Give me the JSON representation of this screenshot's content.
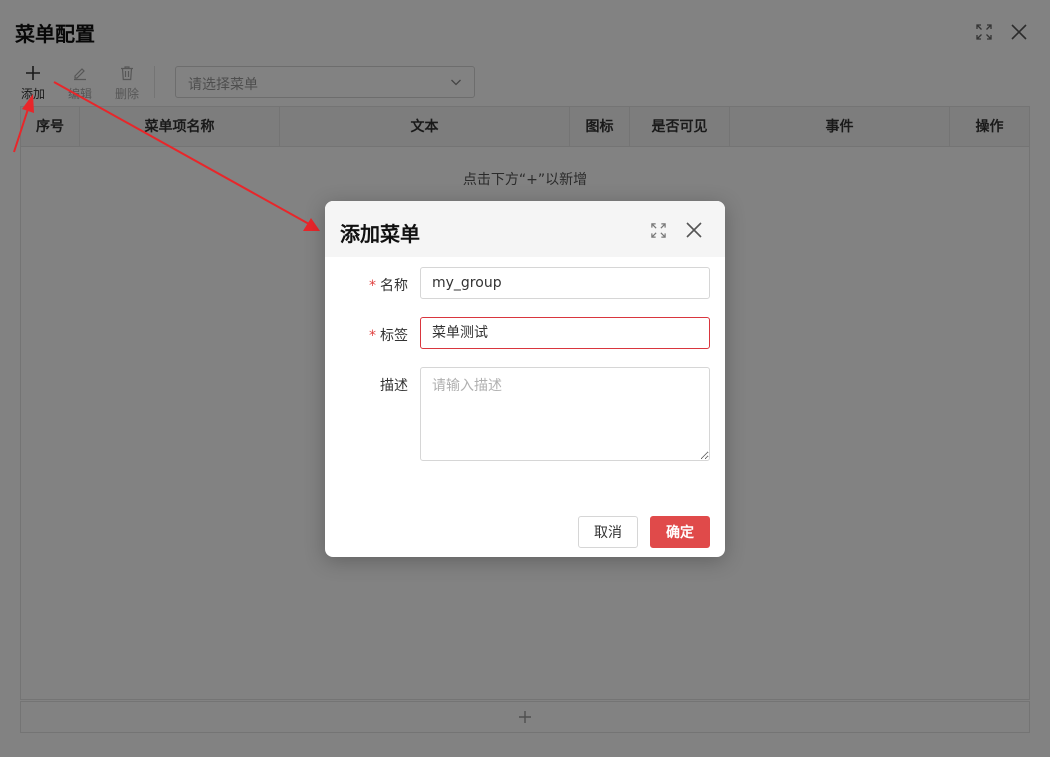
{
  "window": {
    "title": "菜单配置",
    "toolbar": {
      "add_label": "添加",
      "edit_label": "编辑",
      "delete_label": "删除",
      "menu_select_placeholder": "请选择菜单"
    },
    "table": {
      "columns": [
        "序号",
        "菜单项名称",
        "文本",
        "图标",
        "是否可见",
        "事件",
        "操作"
      ],
      "empty_hint": "点击下方“+”以新增",
      "add_row_symbol": "+"
    }
  },
  "dialog": {
    "title": "添加菜单",
    "fields": {
      "name": {
        "label": "名称",
        "required": "*",
        "value": "my_group"
      },
      "tag": {
        "label": "标签",
        "required": "*",
        "value": "菜单测试"
      },
      "description": {
        "label": "描述",
        "placeholder": "请输入描述",
        "value": ""
      }
    },
    "buttons": {
      "cancel": "取消",
      "ok": "确定"
    }
  },
  "colors": {
    "accent": "#e04a4a",
    "annotation_arrow": "#e8262a",
    "mask": "rgba(0,0,0,0.49)"
  },
  "icons": {
    "window_maximize": "expand-icon",
    "window_close": "close-icon",
    "add": "plus-icon",
    "edit": "pencil-icon",
    "delete": "trash-icon",
    "select_dropdown": "chevron-down-icon"
  }
}
